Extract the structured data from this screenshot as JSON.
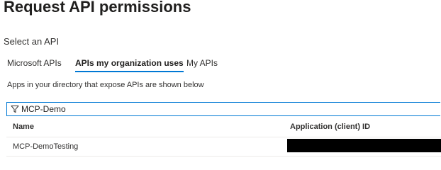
{
  "header": {
    "title": "Request API permissions"
  },
  "select_api": {
    "label": "Select an API"
  },
  "tabs": [
    {
      "label": "Microsoft APIs",
      "active": false
    },
    {
      "label": "APIs my organization uses",
      "active": true
    },
    {
      "label": "My APIs",
      "active": false
    }
  ],
  "description": "Apps in your directory that expose APIs are shown below",
  "filter": {
    "icon": "filter-icon",
    "value": "MCP-Demo"
  },
  "table": {
    "columns": [
      "Name",
      "Application (client) ID"
    ],
    "rows": [
      {
        "name": "MCP-DemoTesting",
        "client_id_redacted": true
      }
    ]
  },
  "colors": {
    "accent": "#0078d4",
    "redaction": "#000000",
    "divider": "#edebe9"
  }
}
